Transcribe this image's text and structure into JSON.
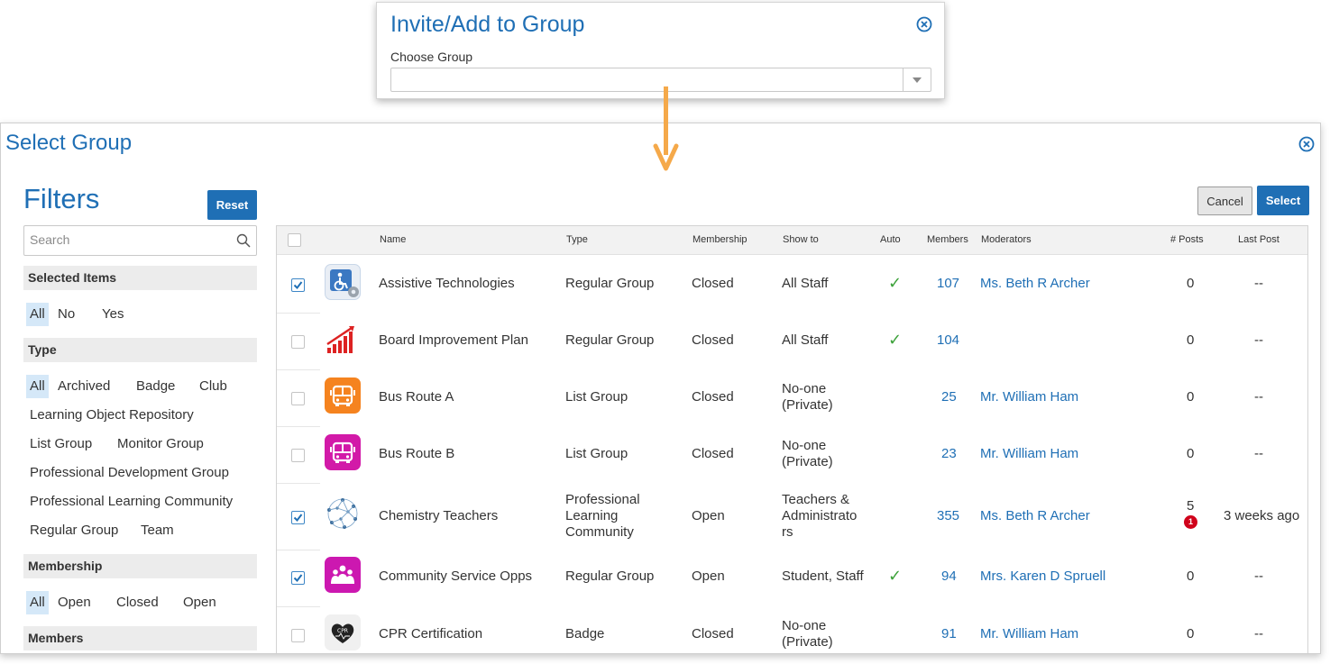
{
  "invite_dialog": {
    "title": "Invite/Add to Group",
    "choose_label": "Choose Group",
    "select_value": ""
  },
  "select_dialog": {
    "title": "Select Group",
    "cancel_label": "Cancel",
    "select_label": "Select"
  },
  "filters": {
    "title": "Filters",
    "reset_label": "Reset",
    "search_placeholder": "Search",
    "sections": [
      {
        "title": "Selected Items",
        "options": [
          "All",
          "No",
          "Yes"
        ]
      },
      {
        "title": "Type",
        "options": [
          "All",
          "Archived",
          "Badge",
          "Club",
          "Learning Object Repository",
          "List Group",
          "Monitor Group",
          "Professional Development Group",
          "Professional Learning Community",
          "Regular Group",
          "Team"
        ]
      },
      {
        "title": "Membership",
        "options": [
          "All",
          "Open",
          "Closed",
          "Open"
        ]
      },
      {
        "title": "Members",
        "options": []
      }
    ]
  },
  "table": {
    "columns": [
      "Name",
      "Type",
      "Membership",
      "Show to",
      "Auto",
      "Members",
      "Moderators",
      "# Posts",
      "Last Post"
    ],
    "rows": [
      {
        "checked": true,
        "icon": "assistive-tech-icon",
        "name": "Assistive Technologies",
        "type": "Regular Group",
        "membership": "Closed",
        "show_to": "All Staff",
        "auto": "✓",
        "members": "107",
        "moderator": "Ms. Beth R Archer",
        "posts": "0",
        "badge": "",
        "last_post": "--"
      },
      {
        "checked": false,
        "icon": "bar-chart-icon",
        "name": "Board Improvement Plan",
        "type": "Regular Group",
        "membership": "Closed",
        "show_to": "All Staff",
        "auto": "✓",
        "members": "104",
        "moderator": "",
        "posts": "0",
        "badge": "",
        "last_post": "--"
      },
      {
        "checked": false,
        "icon": "bus-icon",
        "name": "Bus Route A",
        "type": "List Group",
        "membership": "Closed",
        "show_to": "No-one (Private)",
        "auto": "",
        "members": "25",
        "moderator": "Mr. William Ham",
        "posts": "0",
        "badge": "",
        "last_post": "--"
      },
      {
        "checked": false,
        "icon": "bus-icon",
        "name": "Bus Route B",
        "type": "List Group",
        "membership": "Closed",
        "show_to": "No-one (Private)",
        "auto": "",
        "members": "23",
        "moderator": "Mr. William Ham",
        "posts": "0",
        "badge": "",
        "last_post": "--"
      },
      {
        "checked": true,
        "icon": "molecule-network-icon",
        "name": "Chemistry Teachers",
        "type": "Professional Learning Community",
        "membership": "Open",
        "show_to": "Teachers & Administrato rs",
        "auto": "",
        "members": "355",
        "moderator": "Ms. Beth R Archer",
        "posts": "5",
        "badge": "1",
        "last_post": "3 weeks ago"
      },
      {
        "checked": true,
        "icon": "people-icon",
        "name": "Community Service Opps",
        "type": "Regular Group",
        "membership": "Open",
        "show_to": "Student, Staff",
        "auto": "✓",
        "members": "94",
        "moderator": "Mrs. Karen D Spruell",
        "posts": "0",
        "badge": "",
        "last_post": "--"
      },
      {
        "checked": false,
        "icon": "cpr-heart-icon",
        "name": "CPR Certification",
        "type": "Badge",
        "membership": "Closed",
        "show_to": "No-one (Private)",
        "auto": "",
        "members": "91",
        "moderator": "Mr. William Ham",
        "posts": "0",
        "badge": "",
        "last_post": "--"
      }
    ]
  },
  "colors": {
    "accent": "#1f6fb5",
    "check": "#3da23a",
    "badge": "#d0021b",
    "arrow": "#f5a94a"
  }
}
